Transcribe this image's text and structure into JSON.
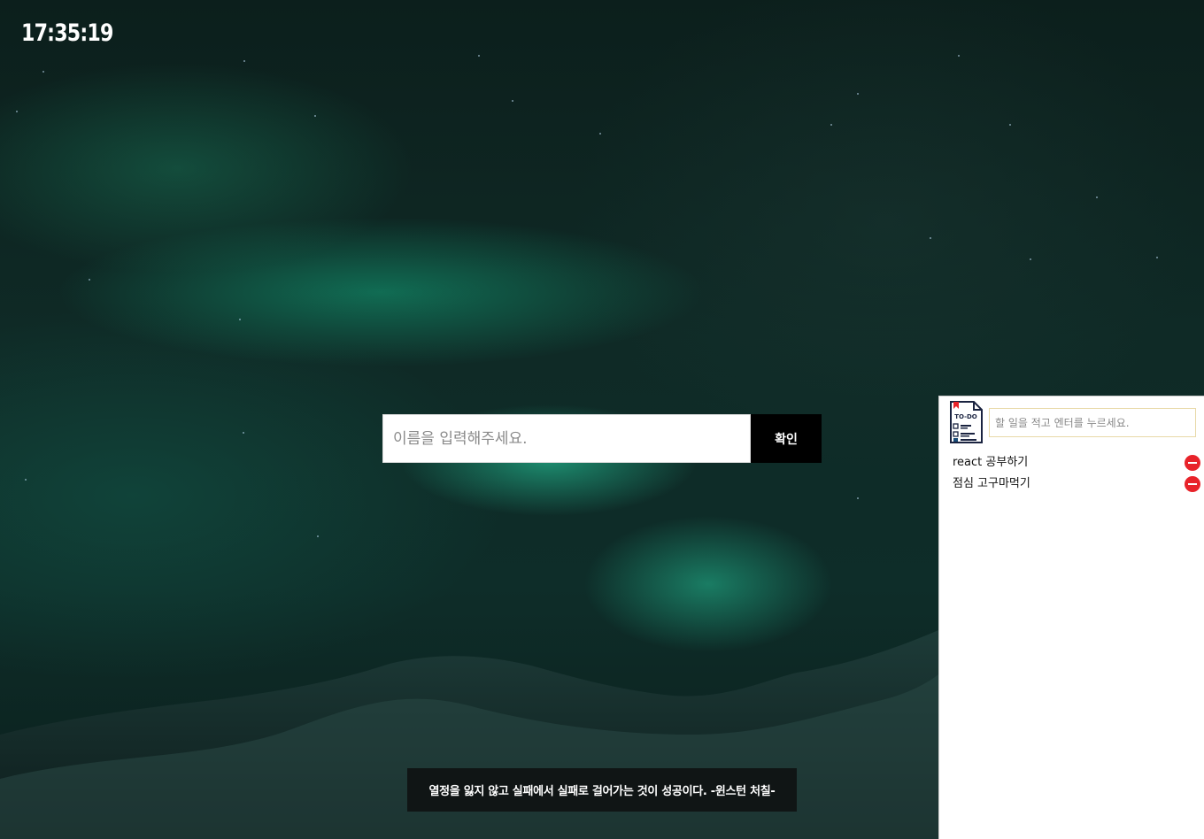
{
  "clock": {
    "time": "17:35:19"
  },
  "name_form": {
    "placeholder": "이름을 입력해주세요.",
    "submit_label": "확인"
  },
  "quote": {
    "text": "열정을 잃지 않고 실패에서 실패로 걸어가는 것이 성공이다. -윈스턴 처칠-"
  },
  "todo": {
    "logo_text": "TO-DO",
    "input_placeholder": "할 일을 적고 엔터를 누르세요.",
    "items": [
      {
        "text": "react 공부하기"
      },
      {
        "text": "점심 고구마먹기"
      }
    ],
    "delete_color": "#e8232a"
  },
  "icons": {
    "todo_logo": "todo-list-icon",
    "delete": "minus-circle-icon"
  }
}
